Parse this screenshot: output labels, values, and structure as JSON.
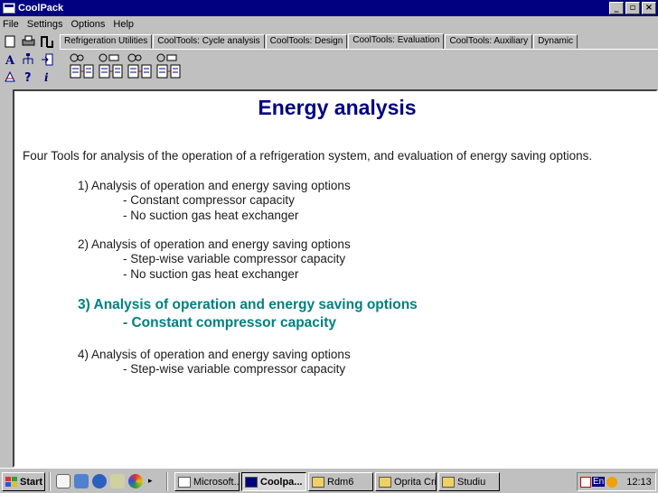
{
  "window": {
    "title": "CoolPack",
    "min": "_",
    "max": "▫",
    "close": "×"
  },
  "menu": [
    "File",
    "Settings",
    "Options",
    "Help"
  ],
  "tabs": [
    "Refrigeration Utilities",
    "CoolTools: Cycle analysis",
    "CoolTools: Design",
    "CoolTools: Evaluation",
    "CoolTools: Auxiliary",
    "Dynamic"
  ],
  "active_tab": "CoolTools: Evaluation",
  "toolbar_icons": [
    "new-document-icon",
    "print-icon",
    "chart-icon",
    "font-icon",
    "hierarchy-icon",
    "import-icon",
    "calculator-icon",
    "help-icon",
    "info-icon"
  ],
  "tool_buttons": [
    "evaluation-tool-1",
    "evaluation-tool-2",
    "evaluation-tool-3",
    "evaluation-tool-4"
  ],
  "content": {
    "title": "Energy analysis",
    "intro": "Four Tools for analysis of the operation of a refrigeration system, and evaluation of energy saving options.",
    "items": [
      {
        "heading": "1) Analysis of operation and energy saving options",
        "lines": [
          "- Constant compressor capacity",
          "- No suction gas heat exchanger"
        ]
      },
      {
        "heading": "2) Analysis of operation and energy saving options",
        "lines": [
          "- Step-wise variable compressor capacity",
          "- No suction gas heat exchanger"
        ]
      },
      {
        "heading": "3) Analysis of operation and energy saving options",
        "lines": [
          "- Constant compressor capacity"
        ]
      },
      {
        "heading": "4) Analysis of operation and energy saving options",
        "lines": [
          "- Step-wise variable compressor capacity"
        ]
      }
    ],
    "highlight_color": "#008080"
  },
  "taskbar": {
    "start": "Start",
    "tasks": [
      "Microsoft...",
      "Coolpa...",
      "Rdm6",
      "Oprita Cri...",
      "Studiu"
    ],
    "active_task": "Coolpa...",
    "language": "En",
    "clock": "12:13"
  }
}
